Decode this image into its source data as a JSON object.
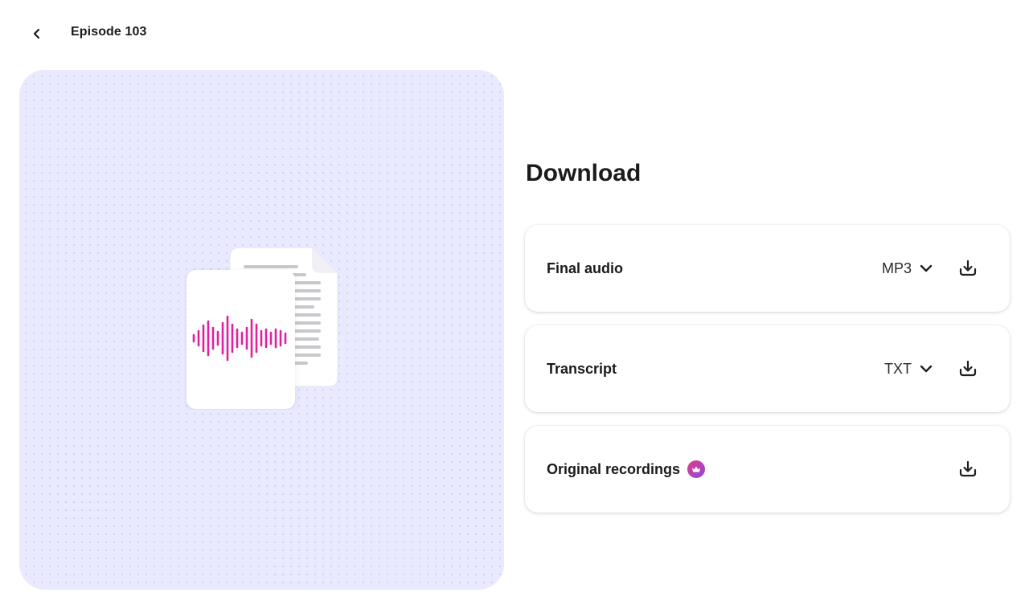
{
  "header": {
    "back_icon": "chevron-left-icon",
    "title": "Episode 103"
  },
  "preview": {
    "background_color": "#e9e9ff",
    "waveform_color": "#e0209e",
    "icons": [
      "audio-file-icon",
      "document-icon"
    ]
  },
  "download": {
    "heading": "Download",
    "items": [
      {
        "label": "Final audio",
        "format": "MP3",
        "has_format_select": true,
        "premium": false,
        "download_icon": "download-icon"
      },
      {
        "label": "Transcript",
        "format": "TXT",
        "has_format_select": true,
        "premium": false,
        "download_icon": "download-icon"
      },
      {
        "label": "Original recordings",
        "format": null,
        "has_format_select": false,
        "premium": true,
        "premium_icon": "crown-icon",
        "download_icon": "download-icon"
      }
    ]
  }
}
